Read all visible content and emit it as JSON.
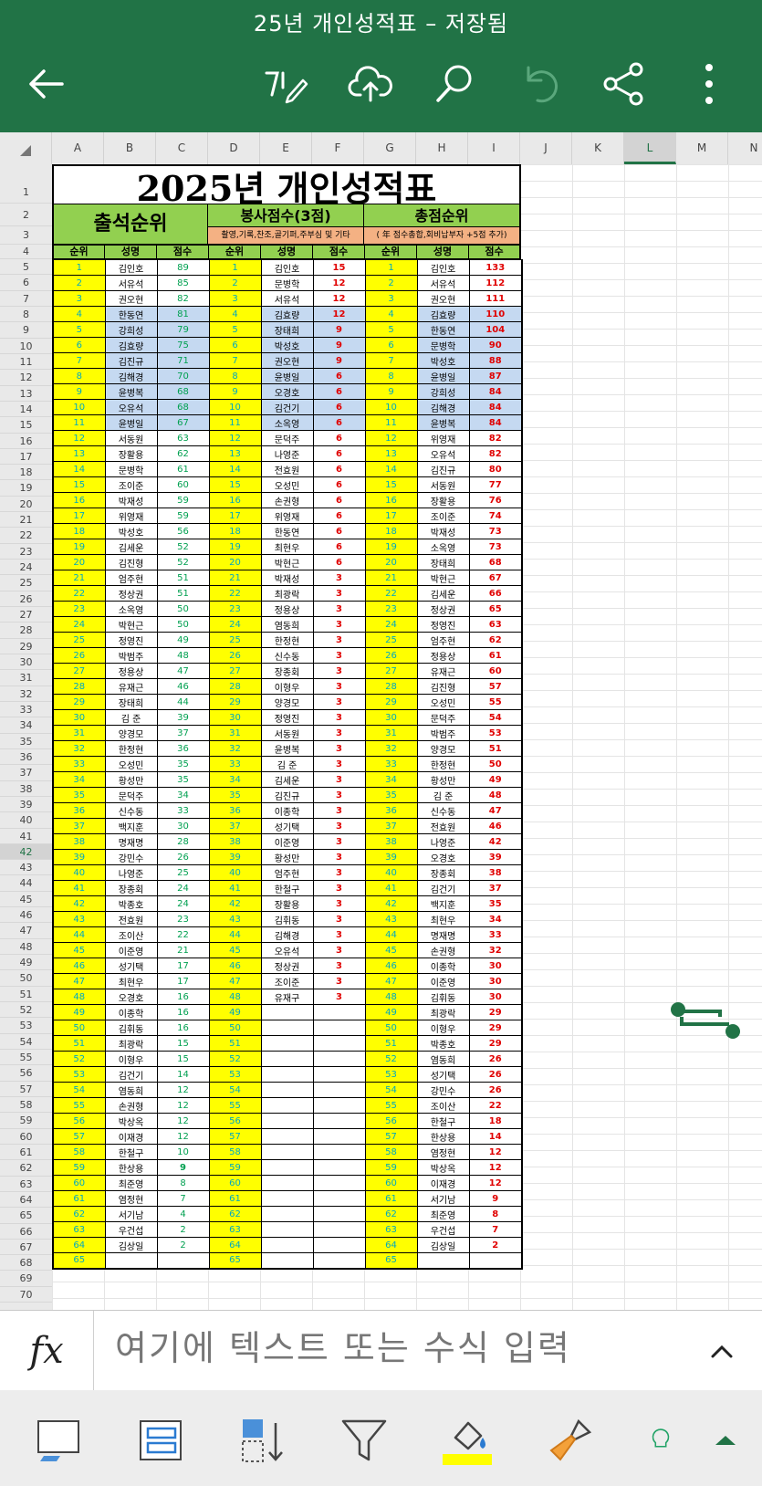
{
  "app": {
    "title": "25년 개인성적표 – 저장됨",
    "toolbar_icons": [
      "back-arrow-icon",
      "pen-edit-icon",
      "cloud-upload-icon",
      "search-icon",
      "undo-icon",
      "share-icon",
      "more-vertical-icon"
    ]
  },
  "columns": [
    "A",
    "B",
    "C",
    "D",
    "E",
    "F",
    "G",
    "H",
    "I",
    "J",
    "K",
    "L",
    "M",
    "N"
  ],
  "selected_column": "L",
  "selected_row": 42,
  "sheet": {
    "main_title": "2025년 개인성적표",
    "sections": {
      "attendance": "출석순위",
      "service": "봉사점수(3점)",
      "service_sub": "촬영,기록,찬조,골기퍼,주부심 및 기타",
      "total": "총점순위",
      "total_sub": "( 年 점수총합,회비납부자 +5점 추가)"
    },
    "headers": [
      "순위",
      "성명",
      "점수",
      "순위",
      "성명",
      "점수",
      "순위",
      "성명",
      "점수"
    ],
    "attendance": [
      [
        "김인호",
        89
      ],
      [
        "서유석",
        85
      ],
      [
        "권오현",
        82
      ],
      [
        "한동연",
        81
      ],
      [
        "강희성",
        79
      ],
      [
        "김효량",
        75
      ],
      [
        "김진규",
        71
      ],
      [
        "김해경",
        70
      ],
      [
        "윤병복",
        68
      ],
      [
        "오유석",
        68
      ],
      [
        "윤병일",
        67
      ],
      [
        "서동원",
        63
      ],
      [
        "장활용",
        62
      ],
      [
        "문병학",
        61
      ],
      [
        "조이준",
        60
      ],
      [
        "박재성",
        59
      ],
      [
        "위영재",
        59
      ],
      [
        "박성호",
        56
      ],
      [
        "김세운",
        52
      ],
      [
        "김진형",
        52
      ],
      [
        "엄주현",
        51
      ],
      [
        "정상권",
        51
      ],
      [
        "소옥영",
        50
      ],
      [
        "박현근",
        50
      ],
      [
        "정영진",
        49
      ],
      [
        "박범주",
        48
      ],
      [
        "정용상",
        47
      ],
      [
        "유재근",
        46
      ],
      [
        "장태희",
        44
      ],
      [
        "김 준",
        39
      ],
      [
        "양경모",
        37
      ],
      [
        "한정현",
        36
      ],
      [
        "오성민",
        35
      ],
      [
        "황성만",
        35
      ],
      [
        "문덕주",
        34
      ],
      [
        "신수동",
        33
      ],
      [
        "백지훈",
        30
      ],
      [
        "명재명",
        28
      ],
      [
        "강민수",
        26
      ],
      [
        "나영준",
        25
      ],
      [
        "장종회",
        24
      ],
      [
        "박종호",
        24
      ],
      [
        "전효원",
        23
      ],
      [
        "조이산",
        22
      ],
      [
        "이준영",
        21
      ],
      [
        "성기택",
        17
      ],
      [
        "최현우",
        17
      ],
      [
        "오경호",
        16
      ],
      [
        "이종학",
        16
      ],
      [
        "김휘동",
        16
      ],
      [
        "최광락",
        15
      ],
      [
        "이형우",
        15
      ],
      [
        "김건기",
        14
      ],
      [
        "염동희",
        12
      ],
      [
        "손권형",
        12
      ],
      [
        "박상옥",
        12
      ],
      [
        "이재경",
        12
      ],
      [
        "한철구",
        10
      ],
      [
        "한상용",
        9
      ],
      [
        "최준영",
        8
      ],
      [
        "염정현",
        7
      ],
      [
        "서기남",
        4
      ],
      [
        "우건섭",
        2
      ],
      [
        "김상일",
        2
      ],
      [
        "",
        ""
      ]
    ],
    "service": [
      [
        "김인호",
        15
      ],
      [
        "문병학",
        12
      ],
      [
        "서유석",
        12
      ],
      [
        "김효량",
        12
      ],
      [
        "장태희",
        9
      ],
      [
        "박성호",
        9
      ],
      [
        "권오현",
        9
      ],
      [
        "윤병일",
        6
      ],
      [
        "오경호",
        6
      ],
      [
        "김건기",
        6
      ],
      [
        "소옥영",
        6
      ],
      [
        "문덕주",
        6
      ],
      [
        "나영준",
        6
      ],
      [
        "전효원",
        6
      ],
      [
        "오성민",
        6
      ],
      [
        "손권형",
        6
      ],
      [
        "위영재",
        6
      ],
      [
        "한동연",
        6
      ],
      [
        "최현우",
        6
      ],
      [
        "박현근",
        6
      ],
      [
        "박재성",
        3
      ],
      [
        "최광락",
        3
      ],
      [
        "정용상",
        3
      ],
      [
        "염동희",
        3
      ],
      [
        "한정현",
        3
      ],
      [
        "신수동",
        3
      ],
      [
        "장종회",
        3
      ],
      [
        "이형우",
        3
      ],
      [
        "양경모",
        3
      ],
      [
        "정영진",
        3
      ],
      [
        "서동원",
        3
      ],
      [
        "윤병복",
        3
      ],
      [
        "김 준",
        3
      ],
      [
        "김세운",
        3
      ],
      [
        "김진규",
        3
      ],
      [
        "이종학",
        3
      ],
      [
        "성기택",
        3
      ],
      [
        "이준영",
        3
      ],
      [
        "황성만",
        3
      ],
      [
        "엄주현",
        3
      ],
      [
        "한철구",
        3
      ],
      [
        "장활용",
        3
      ],
      [
        "김휘동",
        3
      ],
      [
        "김해경",
        3
      ],
      [
        "오유석",
        3
      ],
      [
        "정상권",
        3
      ],
      [
        "조이준",
        3
      ],
      [
        "유재구",
        3
      ]
    ],
    "total": [
      [
        "김인호",
        133
      ],
      [
        "서유석",
        112
      ],
      [
        "권오현",
        111
      ],
      [
        "김효량",
        110
      ],
      [
        "한동연",
        104
      ],
      [
        "문병학",
        90
      ],
      [
        "박성호",
        88
      ],
      [
        "윤병일",
        87
      ],
      [
        "강희성",
        84
      ],
      [
        "김해경",
        84
      ],
      [
        "윤병복",
        84
      ],
      [
        "위영재",
        82
      ],
      [
        "오유석",
        82
      ],
      [
        "김진규",
        80
      ],
      [
        "서동원",
        77
      ],
      [
        "장활용",
        76
      ],
      [
        "조이준",
        74
      ],
      [
        "박재성",
        73
      ],
      [
        "소옥영",
        73
      ],
      [
        "장태희",
        68
      ],
      [
        "박현근",
        67
      ],
      [
        "김세운",
        66
      ],
      [
        "정상권",
        65
      ],
      [
        "정영진",
        63
      ],
      [
        "엄주현",
        62
      ],
      [
        "정용상",
        61
      ],
      [
        "유재근",
        60
      ],
      [
        "김진형",
        57
      ],
      [
        "오성민",
        55
      ],
      [
        "문덕주",
        54
      ],
      [
        "박범주",
        53
      ],
      [
        "양경모",
        51
      ],
      [
        "한정현",
        50
      ],
      [
        "황성만",
        49
      ],
      [
        "김 준",
        48
      ],
      [
        "신수동",
        47
      ],
      [
        "전효원",
        46
      ],
      [
        "나영준",
        42
      ],
      [
        "오경호",
        39
      ],
      [
        "장종회",
        38
      ],
      [
        "김건기",
        37
      ],
      [
        "백지훈",
        35
      ],
      [
        "최현우",
        34
      ],
      [
        "명재명",
        33
      ],
      [
        "손권형",
        32
      ],
      [
        "이종학",
        30
      ],
      [
        "이준영",
        30
      ],
      [
        "김휘동",
        30
      ],
      [
        "최광락",
        29
      ],
      [
        "이형우",
        29
      ],
      [
        "박종호",
        29
      ],
      [
        "염동희",
        26
      ],
      [
        "성기택",
        26
      ],
      [
        "강민수",
        26
      ],
      [
        "조이산",
        22
      ],
      [
        "한철구",
        18
      ],
      [
        "한상용",
        14
      ],
      [
        "염정현",
        12
      ],
      [
        "박상옥",
        12
      ],
      [
        "이재경",
        12
      ],
      [
        "서기남",
        9
      ],
      [
        "최준영",
        8
      ],
      [
        "우건섭",
        7
      ],
      [
        "김상일",
        2
      ],
      [
        "",
        ""
      ]
    ]
  },
  "formula_bar": {
    "fx_label": "fx",
    "placeholder": "여기에 텍스트 또는 수식 입력"
  },
  "bottom_toolbar_icons": [
    "cell-border-icon",
    "merge-cells-icon",
    "insert-rows-icon",
    "filter-icon",
    "fill-color-icon",
    "format-painter-icon",
    "lightbulb-icon",
    "expand-up-icon"
  ],
  "colors": {
    "brand": "#217346",
    "header_green": "#92d050",
    "rank_yellow": "#ffff00",
    "highlight_blue": "#c5d9f1",
    "sub_orange": "#f4b183",
    "fill_yellow": "#ffff00"
  }
}
